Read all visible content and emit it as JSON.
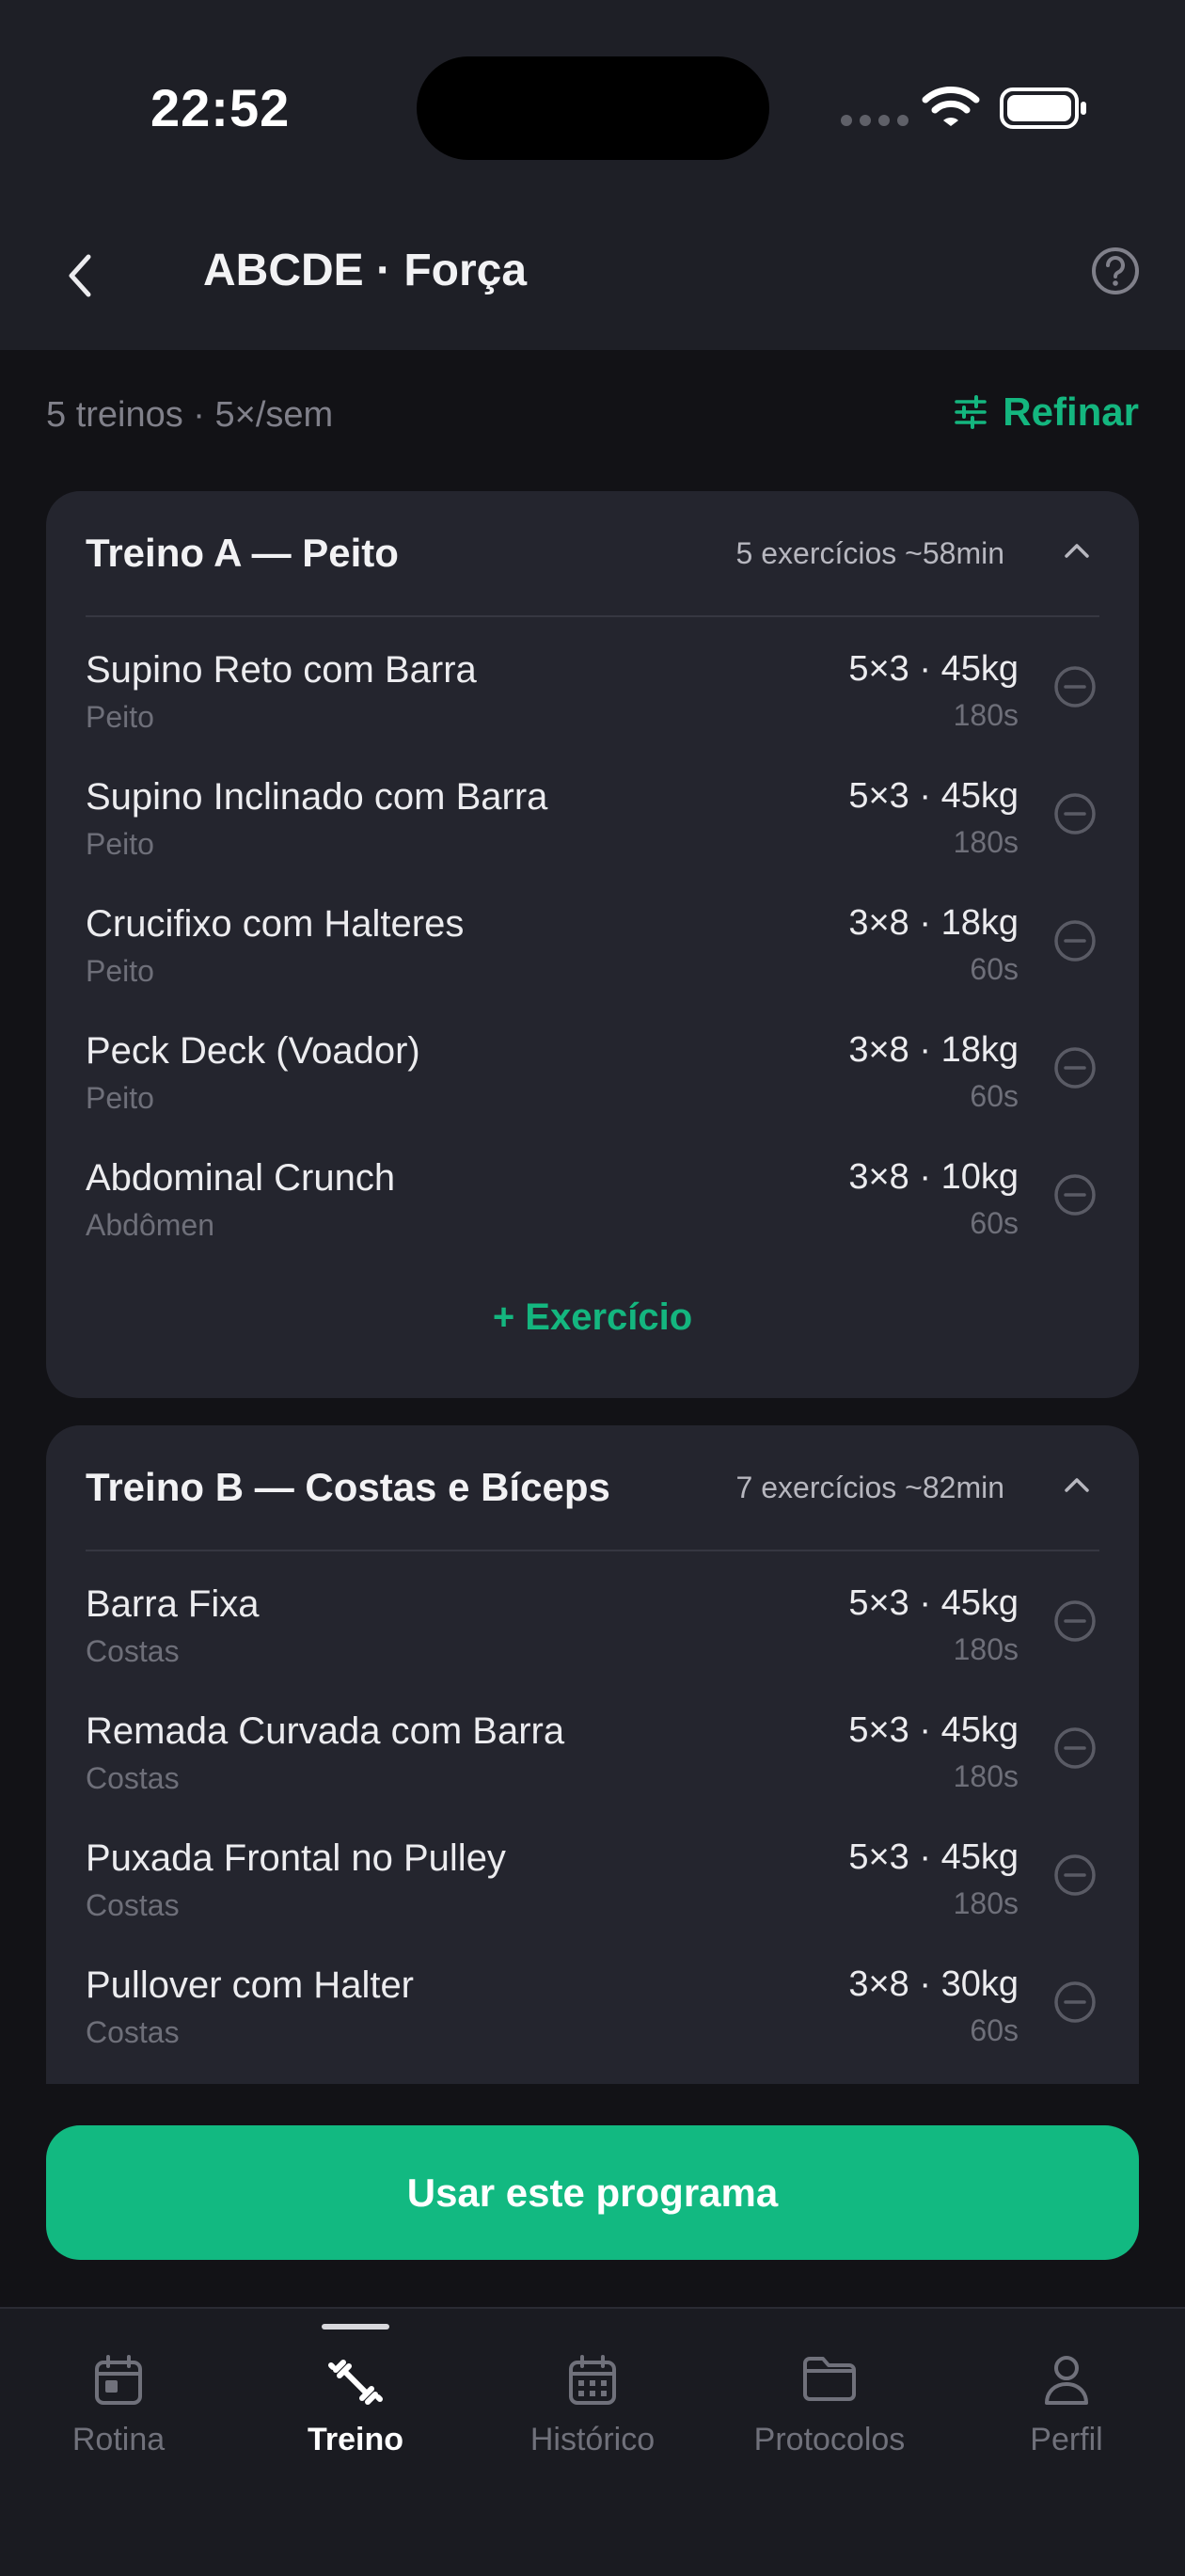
{
  "status_bar": {
    "time": "22:52"
  },
  "header": {
    "title": "ABCDE · Força"
  },
  "summary": {
    "text": "5 treinos · 5×/sem",
    "refine_label": "Refinar"
  },
  "workouts": [
    {
      "title": "Treino A — Peito",
      "meta": "5 exercícios  ~58min",
      "exercises": [
        {
          "name": "Supino Reto com Barra",
          "group": "Peito",
          "sets": "5×3 · 45kg",
          "rest": "180s"
        },
        {
          "name": "Supino Inclinado com Barra",
          "group": "Peito",
          "sets": "5×3 · 45kg",
          "rest": "180s"
        },
        {
          "name": "Crucifixo com Halteres",
          "group": "Peito",
          "sets": "3×8 · 18kg",
          "rest": "60s"
        },
        {
          "name": "Peck Deck (Voador)",
          "group": "Peito",
          "sets": "3×8 · 18kg",
          "rest": "60s"
        },
        {
          "name": "Abdominal Crunch",
          "group": "Abdômen",
          "sets": "3×8 · 10kg",
          "rest": "60s"
        }
      ],
      "add_label": "+ Exercício"
    },
    {
      "title": "Treino B — Costas e Bíceps",
      "meta": "7 exercícios  ~82min",
      "exercises": [
        {
          "name": "Barra Fixa",
          "group": "Costas",
          "sets": "5×3 · 45kg",
          "rest": "180s"
        },
        {
          "name": "Remada Curvada com Barra",
          "group": "Costas",
          "sets": "5×3 · 45kg",
          "rest": "180s"
        },
        {
          "name": "Puxada Frontal no Pulley",
          "group": "Costas",
          "sets": "5×3 · 45kg",
          "rest": "180s"
        },
        {
          "name": "Pullover com Halter",
          "group": "Costas",
          "sets": "3×8 · 30kg",
          "rest": "60s"
        }
      ]
    }
  ],
  "cta": {
    "label": "Usar este programa"
  },
  "tabs": [
    {
      "label": "Rotina",
      "icon": "calendar-icon",
      "active": false
    },
    {
      "label": "Treino",
      "icon": "dumbbell-icon",
      "active": true
    },
    {
      "label": "Histórico",
      "icon": "calendar-grid-icon",
      "active": false
    },
    {
      "label": "Protocolos",
      "icon": "folder-icon",
      "active": false
    },
    {
      "label": "Perfil",
      "icon": "user-icon",
      "active": false
    }
  ],
  "colors": {
    "accent": "#12B981",
    "background": "#121216",
    "card": "#24252E",
    "header": "#1E1F26"
  }
}
